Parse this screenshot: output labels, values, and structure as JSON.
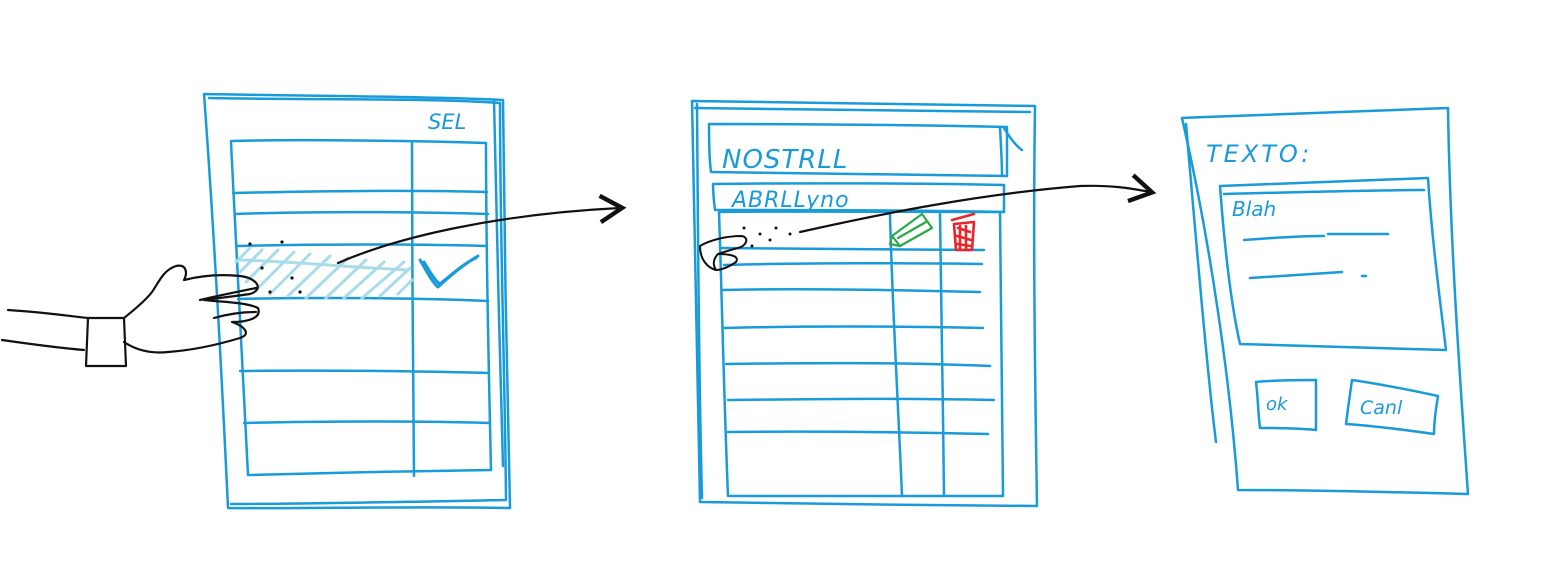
{
  "colors": {
    "sketch": "#1a9bd9",
    "ink": "#111111",
    "highlight": "#a9dcea",
    "edit_icon": "#2aa84a",
    "delete_icon": "#e8262b"
  },
  "screen1": {
    "header_label": "SEL"
  },
  "screen2": {
    "field_name": "NOSTRLL",
    "field_surname": "ABRLLyno"
  },
  "screen3": {
    "label": "TEXTO:",
    "text_line": "Blah",
    "button_ok": "ok",
    "button_cancel": "Canl"
  },
  "icons": {
    "hand": "pointing-hand-icon",
    "check": "checkmark-icon",
    "edit": "pencil-icon",
    "delete": "trash-icon",
    "arrow": "arrow-right-icon"
  }
}
